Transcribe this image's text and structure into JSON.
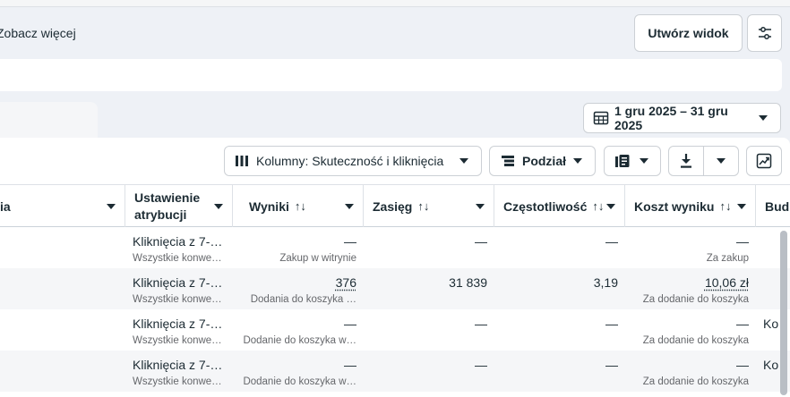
{
  "header": {
    "see_more": "Zobacz więcej",
    "create_view": "Utwórz widok"
  },
  "toolbar": {
    "date_range": "1 gru 2025 – 31 gru 2025",
    "columns": "Kolumny: Skuteczność i kliknięcia",
    "breakdown": "Podział"
  },
  "table": {
    "headers": {
      "col_a": "ia",
      "attribution": "Ustawienie\natrybucji",
      "results": "Wyniki",
      "reach": "Zasięg",
      "frequency": "Częstotliwość",
      "cost_per_result": "Koszt wyniku",
      "budget": "Bud"
    },
    "sort_glyph": "↑↓",
    "rows": [
      {
        "attribution": "Kliknięcia z 7-…",
        "attribution_sub": "Wszystkie konwe…",
        "results": "—",
        "results_sub": "Zakup w witrynie",
        "reach": "—",
        "frequency": "—",
        "cost": "—",
        "cost_sub": "Za zakup",
        "budget": ""
      },
      {
        "attribution": "Kliknięcia z 7-…",
        "attribution_sub": "Wszystkie konwe…",
        "results": "376",
        "results_sub": "Dodania do koszyka …",
        "reach": "31 839",
        "frequency": "3,19",
        "cost": "10,06 zł",
        "cost_sub": "Za dodanie do koszyka",
        "budget": ""
      },
      {
        "attribution": "Kliknięcia z 7-…",
        "attribution_sub": "Wszystkie konwe…",
        "results": "—",
        "results_sub": "Dodanie do koszyka w…",
        "reach": "—",
        "frequency": "—",
        "cost": "—",
        "cost_sub": "Za dodanie do koszyka",
        "budget": "Ko"
      },
      {
        "attribution": "Kliknięcia z 7-…",
        "attribution_sub": "Wszystkie konwe…",
        "results": "—",
        "results_sub": "Dodanie do koszyka w…",
        "reach": "—",
        "frequency": "—",
        "cost": "—",
        "cost_sub": "Za dodanie do koszyka",
        "budget": "Ko"
      }
    ]
  },
  "icons": {
    "settings": "sliders-icon",
    "calendar": "calendar-icon",
    "columns": "columns-icon",
    "breakdown": "breakdown-icon",
    "reports": "reports-icon",
    "export": "download-icon",
    "chart": "chart-icon"
  }
}
